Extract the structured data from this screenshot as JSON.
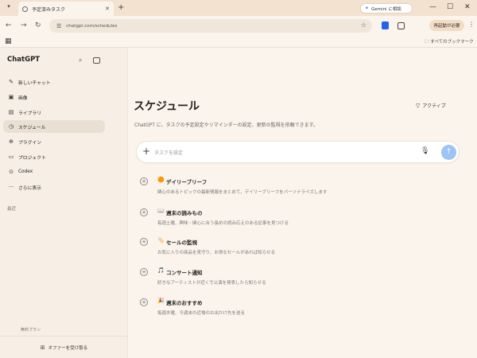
{
  "browser": {
    "tab_title": "予定済みタスク",
    "url": "chatgpt.com/schedules",
    "gemini_label": "Gemini に相談",
    "profile_label": "再起動が必要",
    "bookmarks_label": "すべてのブックマーク"
  },
  "sidebar": {
    "brand": "ChatGPT",
    "items": [
      {
        "label": "新しいチャット",
        "icon": "new-chat-icon"
      },
      {
        "label": "画像",
        "icon": "image-icon"
      },
      {
        "label": "ライブラリ",
        "icon": "library-icon"
      },
      {
        "label": "スケジュール",
        "icon": "clock-icon"
      },
      {
        "label": "プラグイン",
        "icon": "plugin-icon"
      },
      {
        "label": "プロジェクト",
        "icon": "folder-icon"
      },
      {
        "label": "Codex",
        "icon": "codex-icon"
      },
      {
        "label": "さらに表示",
        "icon": "more-icon"
      }
    ],
    "recent_label": "最近",
    "footnote": "無料プラン",
    "bottom_label": "オファーを受け取る"
  },
  "main": {
    "title": "スケジュール",
    "filter_label": "アクティブ",
    "description": "ChatGPT に、タスクの予定設定やリマインダーの設定、更新の監視を依頼できます。",
    "composer_placeholder": "タスクを設定",
    "suggestions": [
      {
        "emoji": "🟠",
        "title": "デイリーブリーフ",
        "desc": "関心のあるトピックの最新情報をまとめて、デイリーブリーフをパーソナライズします"
      },
      {
        "emoji": "📖",
        "title": "週末の読みもの",
        "desc": "毎週土曜、興味・関心に合う長めの読み応えのある記事を見つける"
      },
      {
        "emoji": "🏷️",
        "title": "セールの監視",
        "desc": "お気に入りの商品を見守り、お得なセールがあれば知らせる"
      },
      {
        "emoji": "🎵",
        "title": "コンサート通知",
        "desc": "好きなアーティストが近くで公演を発表したら知らせる"
      },
      {
        "emoji": "🎉",
        "title": "週末のおすすめ",
        "desc": "毎週木曜、今週末の近場のお出かけ先を送る"
      }
    ]
  }
}
